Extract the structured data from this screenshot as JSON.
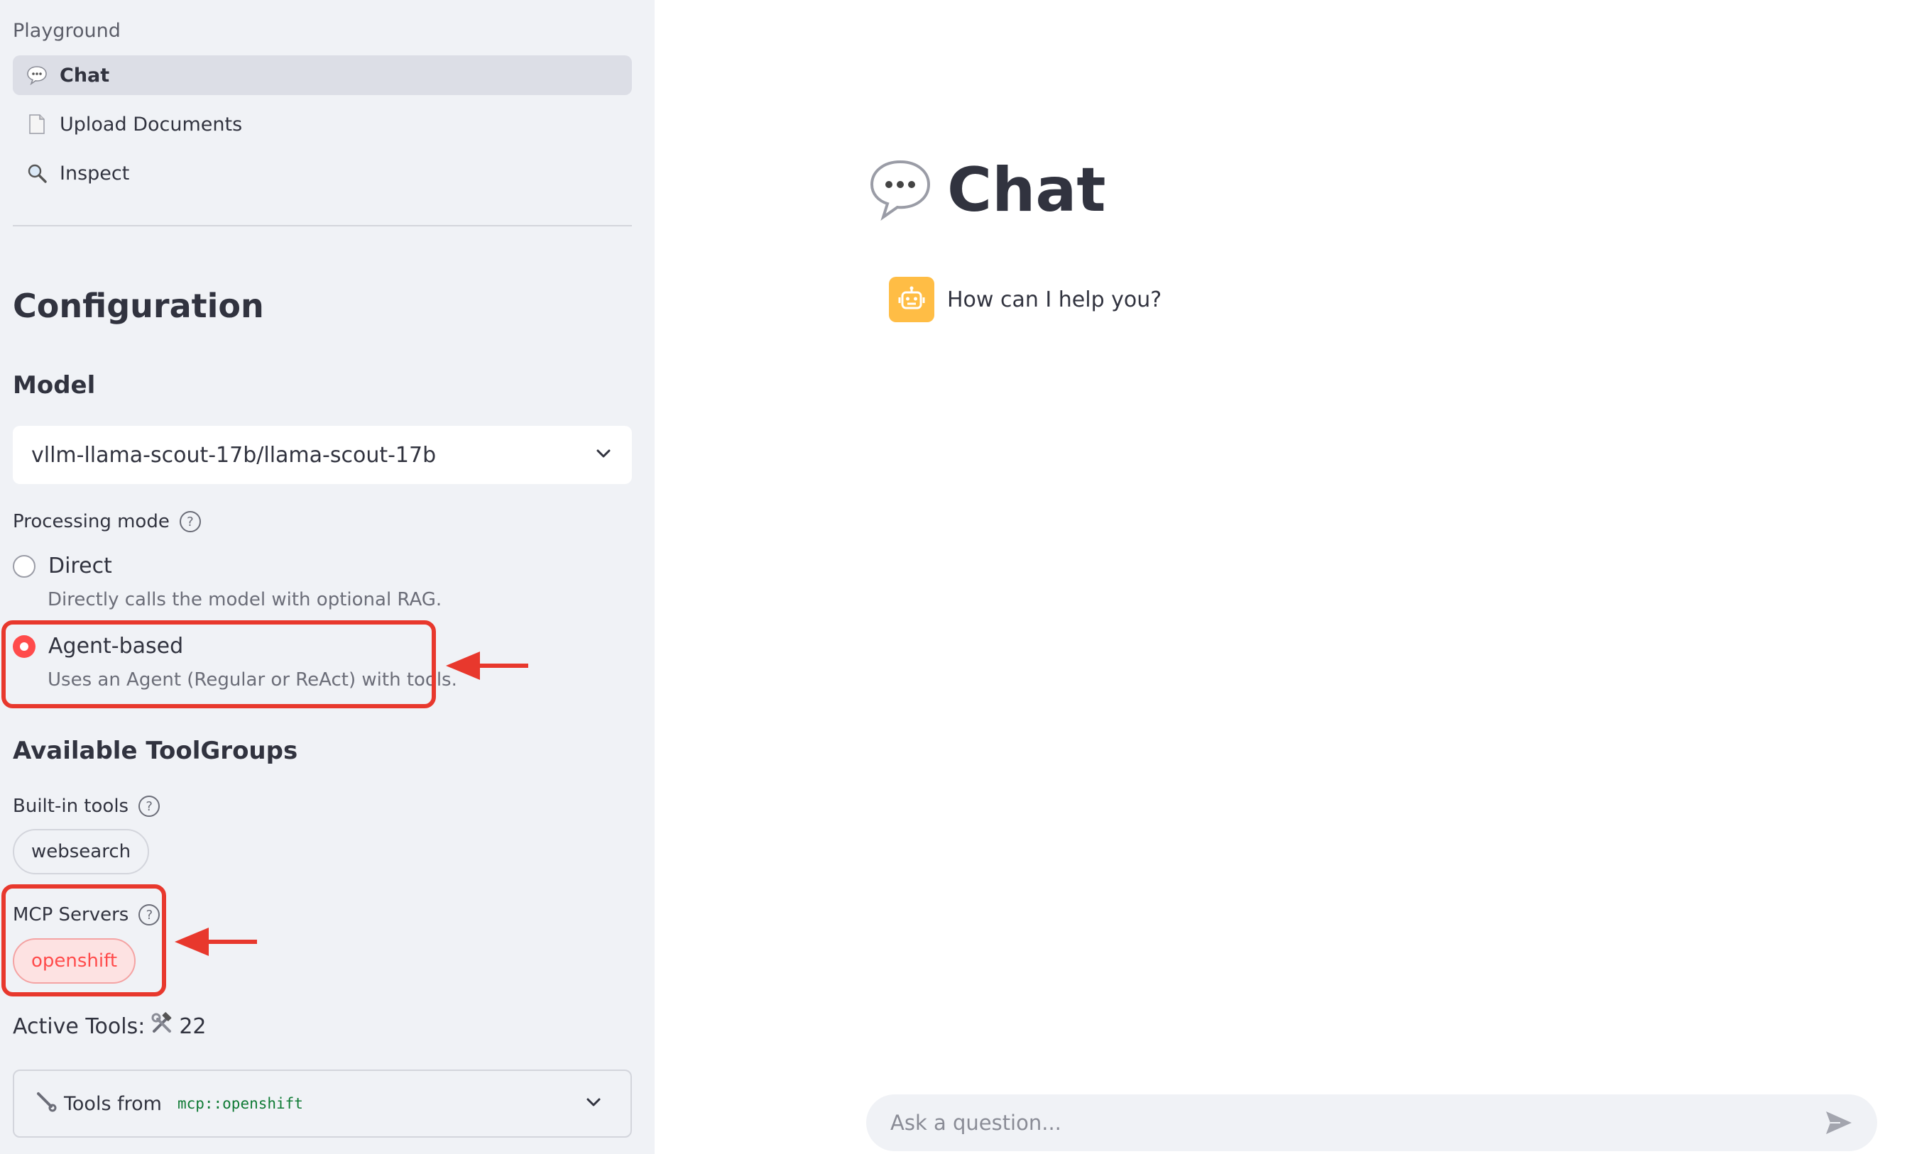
{
  "sidebar": {
    "nav_section_label": "Playground",
    "nav_items": [
      {
        "label": "Chat",
        "icon": "speech-bubble-icon",
        "active": true
      },
      {
        "label": "Upload Documents",
        "icon": "document-icon",
        "active": false
      },
      {
        "label": "Inspect",
        "icon": "magnifier-icon",
        "active": false
      }
    ],
    "configuration_title": "Configuration",
    "model": {
      "heading": "Model",
      "selected": "vllm-llama-scout-17b/llama-scout-17b"
    },
    "processing_mode": {
      "label": "Processing mode",
      "options": [
        {
          "label": "Direct",
          "description": "Directly calls the model with optional RAG.",
          "selected": false
        },
        {
          "label": "Agent-based",
          "description": "Uses an Agent (Regular or ReAct) with tools.",
          "selected": true
        }
      ]
    },
    "toolgroups": {
      "heading": "Available ToolGroups",
      "builtin_label": "Built-in tools",
      "builtin_tools": [
        "websearch"
      ],
      "mcp_label": "MCP Servers",
      "mcp_servers": [
        "openshift"
      ]
    },
    "active_tools": {
      "label": "Active Tools:",
      "icon": "hammer-wrench-icon",
      "count": "22"
    },
    "tools_expander": {
      "prefix": "Tools from",
      "code": "mcp::openshift",
      "icon": "wrench-icon"
    }
  },
  "main": {
    "title": "Chat",
    "title_icon": "speech-bubble-icon",
    "assistant_message": "How can I help you?",
    "chat_input_placeholder": "Ask a question..."
  },
  "colors": {
    "accent": "#ff4b4b",
    "annotation_red": "#e8382d",
    "sidebar_bg": "#f0f2f6",
    "bot_avatar": "#ffbd45"
  }
}
